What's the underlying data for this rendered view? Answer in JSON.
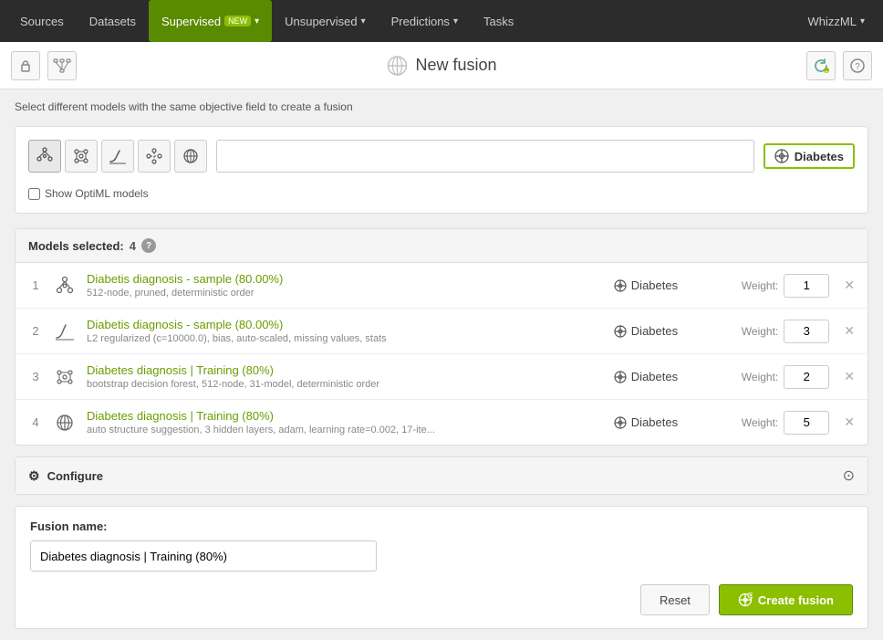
{
  "nav": {
    "items": [
      {
        "label": "Sources",
        "id": "sources",
        "active": false
      },
      {
        "label": "Datasets",
        "id": "datasets",
        "active": false
      },
      {
        "label": "Supervised",
        "id": "supervised",
        "active": true,
        "badge": "NEW"
      },
      {
        "label": "Unsupervised",
        "id": "unsupervised",
        "active": false,
        "dropdown": true
      },
      {
        "label": "Predictions",
        "id": "predictions",
        "active": false,
        "dropdown": true
      },
      {
        "label": "Tasks",
        "id": "tasks",
        "active": false
      }
    ],
    "user": "WhizzML",
    "user_dropdown": true
  },
  "header": {
    "title": "New fusion"
  },
  "info_text": "Select different models with the same objective field to create a fusion",
  "filter": {
    "search_placeholder": "",
    "target_label": "Diabetes",
    "show_optiml_label": "Show OptiML models"
  },
  "models_section": {
    "header": "Models selected:",
    "count": "4",
    "models": [
      {
        "num": "1",
        "icon": "tree-icon",
        "name": "Diabetis diagnosis - sample (80.00%)",
        "desc": "512-node, pruned, deterministic order",
        "target": "Diabetes",
        "weight": "1"
      },
      {
        "num": "2",
        "icon": "logistic-icon",
        "name": "Diabetis diagnosis - sample (80.00%)",
        "desc": "L2 regularized (c=10000.0), bias, auto-scaled, missing values, stats",
        "target": "Diabetes",
        "weight": "3"
      },
      {
        "num": "3",
        "icon": "ensemble-icon",
        "name": "Diabetes diagnosis | Training (80%)",
        "desc": "bootstrap decision forest, 512-node, 31-model, deterministic order",
        "target": "Diabetes",
        "weight": "2"
      },
      {
        "num": "4",
        "icon": "deepnet-icon",
        "name": "Diabetes diagnosis | Training (80%)",
        "desc": "auto structure suggestion, 3 hidden layers, adam, learning rate=0.002, 17-ite...",
        "target": "Diabetes",
        "weight": "5"
      }
    ]
  },
  "configure": {
    "label": "Configure"
  },
  "footer": {
    "fusion_name_label": "Fusion name:",
    "fusion_name_value": "Diabetes diagnosis | Training (80%)",
    "reset_label": "Reset",
    "create_label": "Create fusion"
  }
}
